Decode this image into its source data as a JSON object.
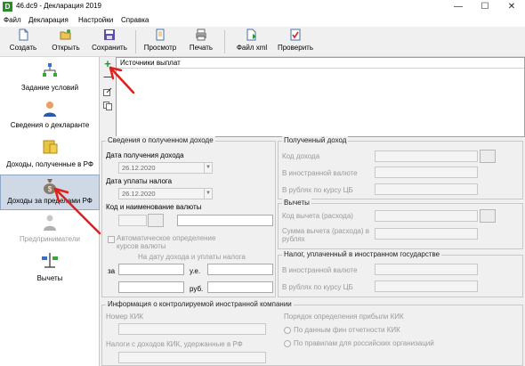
{
  "window": {
    "title": "46.dc9 - Декларация 2019",
    "icon_letter": "D",
    "minimize": "—",
    "maximize": "☐",
    "close": "✕"
  },
  "menu": [
    "Файл",
    "Декларация",
    "Настройки",
    "Справка"
  ],
  "toolbar": {
    "create": "Создать",
    "open": "Открыть",
    "save": "Сохранить",
    "preview": "Просмотр",
    "print": "Печать",
    "xml": "Файл xml",
    "check": "Проверить"
  },
  "nav": {
    "conditions": "Задание условий",
    "declarant": "Сведения о декларанте",
    "income_rf": "Доходы, полученные в РФ",
    "income_abroad": "Доходы за пределами РФ",
    "entrepreneur": "Предприниматели",
    "deductions": "Вычеты"
  },
  "sources": {
    "header": "Источники выплат",
    "add": "+",
    "remove": "—"
  },
  "income_info": {
    "title": "Сведения о полученном доходе",
    "date_received_label": "Дата получения дохода",
    "date_received": "26.12.2020",
    "date_paid_label": "Дата уплаты налога",
    "date_paid": "26.12.2020",
    "currency_label": "Код и наименование валюты",
    "auto_rate_label": "Автоматическое определение курсов валюты",
    "rate_header": "На дату дохода и уплаты налога",
    "per_label": "за",
    "ue_label": "у.е.",
    "rub_label": "руб."
  },
  "received_income": {
    "title": "Полученный доход",
    "code_label": "Код дохода",
    "foreign_label": "В иностранной валюте",
    "rub_label": "В рублях по курсу ЦБ"
  },
  "deductions_box": {
    "title": "Вычеты",
    "code_label": "Код вычета (расхода)",
    "sum_label": "Сумма вычета (расхода) в рублях"
  },
  "foreign_tax": {
    "title": "Налог, уплаченный в иностранном государстве",
    "foreign_label": "В иностранной валюте",
    "rub_label": "В рублях по курсу ЦБ"
  },
  "kik": {
    "title": "Информация о контролируемой иностранной компании",
    "number_label": "Номер КИК",
    "taxes_label": "Налоги с доходов КИК, удержанные в РФ",
    "profit_order_label": "Порядок определения прибыли КИК",
    "option1": "По данным фин отчетности КИК",
    "option2": "По правилам для российских организаций"
  },
  "colors": {
    "annotation_arrow": "#e0201c",
    "nav_selected": "#cfd9e6",
    "add_green": "#1f9a2a"
  }
}
